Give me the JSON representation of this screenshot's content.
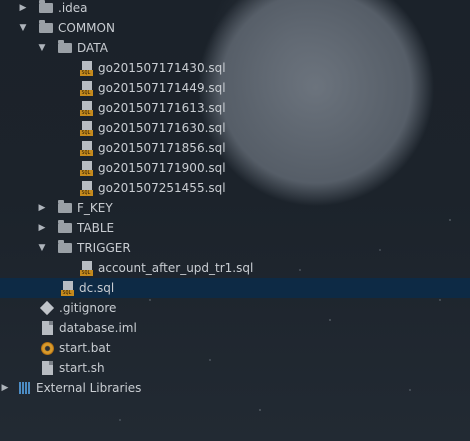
{
  "tree": {
    "items": [
      {
        "label": ".idea",
        "icon": "folder-icon"
      },
      {
        "label": "COMMON",
        "icon": "folder-icon"
      },
      {
        "label": "DATA",
        "icon": "folder-icon"
      },
      {
        "label": "go201507171430.sql",
        "icon": "sql-file-icon"
      },
      {
        "label": "go201507171449.sql",
        "icon": "sql-file-icon"
      },
      {
        "label": "go201507171613.sql",
        "icon": "sql-file-icon"
      },
      {
        "label": "go201507171630.sql",
        "icon": "sql-file-icon"
      },
      {
        "label": "go201507171856.sql",
        "icon": "sql-file-icon"
      },
      {
        "label": "go201507171900.sql",
        "icon": "sql-file-icon"
      },
      {
        "label": "go201507251455.sql",
        "icon": "sql-file-icon"
      },
      {
        "label": "F_KEY",
        "icon": "folder-icon"
      },
      {
        "label": "TABLE",
        "icon": "folder-icon"
      },
      {
        "label": "TRIGGER",
        "icon": "folder-icon"
      },
      {
        "label": "account_after_upd_tr1.sql",
        "icon": "sql-file-icon"
      },
      {
        "label": "dc.sql",
        "icon": "sql-file-icon"
      },
      {
        "label": ".gitignore",
        "icon": "gitignore-icon"
      },
      {
        "label": "database.iml",
        "icon": "module-file-icon"
      },
      {
        "label": "start.bat",
        "icon": "batch-file-icon"
      },
      {
        "label": "start.sh",
        "icon": "shell-file-icon"
      },
      {
        "label": "External Libraries",
        "icon": "libraries-icon"
      }
    ],
    "selected": "dc.sql",
    "selection_color": "#0d2a45",
    "sql_badge_text": "SQL"
  }
}
